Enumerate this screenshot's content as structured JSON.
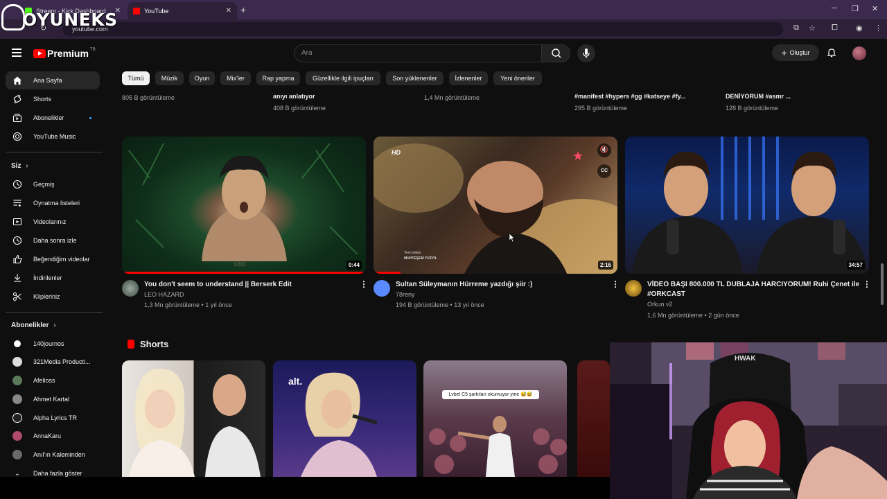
{
  "overlay": {
    "logo_text": "OYUNEKS"
  },
  "browser": {
    "tabs": [
      {
        "label": "Stream - Kick Dashboard",
        "favicon_color": "#53fc18"
      },
      {
        "label": "YouTube",
        "favicon_color": "#ff0000"
      }
    ],
    "new_tab": "+",
    "url": "youtube.com",
    "window_controls": {
      "minimize": "─",
      "restore": "❐",
      "close": "✕"
    }
  },
  "header": {
    "brand": "Premium",
    "region": "TR",
    "search_placeholder": "Ara",
    "create_label": "Oluştur"
  },
  "sidebar": {
    "main": [
      {
        "label": "Ana Sayfa",
        "icon": "home-icon"
      },
      {
        "label": "Shorts",
        "icon": "shorts-icon"
      },
      {
        "label": "Abonelikler",
        "icon": "subscriptions-icon"
      },
      {
        "label": "YouTube Music",
        "icon": "music-icon"
      }
    ],
    "you_header": "Siz",
    "you": [
      {
        "label": "Geçmiş",
        "icon": "history-icon"
      },
      {
        "label": "Oynatma listeleri",
        "icon": "playlists-icon"
      },
      {
        "label": "Videolarınız",
        "icon": "your-videos-icon"
      },
      {
        "label": "Daha sonra izle",
        "icon": "watch-later-icon"
      },
      {
        "label": "Beğendiğim videolar",
        "icon": "liked-icon"
      },
      {
        "label": "İndirilenler",
        "icon": "download-icon"
      },
      {
        "label": "Klipleriniz",
        "icon": "clips-icon"
      }
    ],
    "subs_header": "Abonelikler",
    "subs": [
      {
        "label": "140journos",
        "color": "#ffffff"
      },
      {
        "label": "321Media Producti...",
        "color": "#dddddd"
      },
      {
        "label": "Afelioss",
        "color": "#5a7a5a"
      },
      {
        "label": "Ahmet Kartal",
        "color": "#888888"
      },
      {
        "label": "Alpha Lyrics TR",
        "color": "#222222"
      },
      {
        "label": "AnnaKaru",
        "color": "#b04a6a"
      },
      {
        "label": "Anıl'ın Kaleminden",
        "color": "#6a6a6a"
      }
    ],
    "show_more": "Daha fazla göster"
  },
  "chips": [
    "Tümü",
    "Müzik",
    "Oyun",
    "Mix'ler",
    "Rap yapma",
    "Güzellikle ilgili ipuçları",
    "Son yüklenenler",
    "İzlenenler",
    "Yeni öneriler"
  ],
  "partial_row": {
    "meta1": "805 B görüntüleme",
    "title2": "anıyı anlatıyor",
    "meta2": "408 B görüntüleme",
    "meta3": "1,4 Mn görüntüleme",
    "title4": "#manifest #hypers #gg #katseye #fy...",
    "meta4": "295 B görüntüleme",
    "title5": "DENİYORUM #asmr ...",
    "meta5": "128 B görüntüleme"
  },
  "videos": [
    {
      "title": "You don't seem to understand || Berserk Edit",
      "channel": "LEO HAZARD",
      "meta": "1,3 Mn görüntüleme • 1 yıl önce",
      "duration": "0:44",
      "watermark": "LEO",
      "progress": 1.0
    },
    {
      "title": "Sultan Süleymanın Hürreme yazdığı şiir :)",
      "channel": "78reny",
      "meta": "194 B görüntüleme • 13 yıl önce",
      "duration": "2:16",
      "hd": "HD",
      "caption_line1": "Yeni bölüm",
      "caption_line2": "MUHTEŞEM YÜZYIL",
      "cc": "CC",
      "progress": 0.11
    },
    {
      "title_line1": "VİDEO BAŞI 800.000 TL DUBLAJA HARCIYORUM! Ruhi Çenet ile",
      "title_line2": "#ORKCAST",
      "channel": "Orkun v2",
      "meta": "1,6 Mn görüntüleme • 2 gün önce",
      "duration": "34:57"
    }
  ],
  "shorts": {
    "title": "Shorts",
    "items": [
      {
        "kind": "people"
      },
      {
        "kind": "concert",
        "logo": "alt."
      },
      {
        "kind": "crowd",
        "caption": "Lvbel C5 şarkıları okumuyor yine 😅😅"
      },
      {
        "kind": "partial"
      }
    ]
  },
  "webcam": {
    "chair_brand": "HWAK"
  }
}
